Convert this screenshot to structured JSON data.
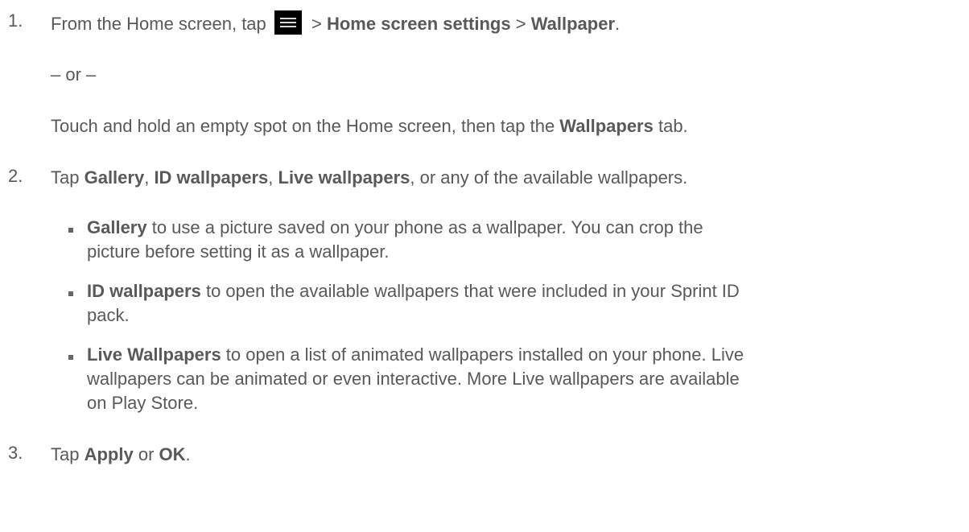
{
  "step1": {
    "number": "1.",
    "pre": "From the Home screen, tap ",
    "icon": "menu-icon",
    "sep1": " > ",
    "bold1": "Home screen settings",
    "sep2": " > ",
    "bold2": "Wallpaper",
    "end": ".",
    "or": "– or –",
    "alt_pre": "Touch and hold an empty spot on the Home screen, then tap the ",
    "alt_bold": "Wallpapers",
    "alt_end": " tab."
  },
  "step2": {
    "number": "2.",
    "pre": "Tap ",
    "b1": "Gallery",
    "s1": ", ",
    "b2": "ID wallpapers",
    "s2": ", ",
    "b3": "Live wallpapers",
    "end": ", or any of the available wallpapers.",
    "bullets": [
      {
        "bold": "Gallery",
        "line1": " to use a picture saved on your phone as a wallpaper. You can crop the",
        "line2": "picture before setting it as a wallpaper."
      },
      {
        "bold": "ID wallpapers",
        "line1": " to open the available wallpapers that were included in your Sprint ID",
        "line2": "pack."
      },
      {
        "bold": "Live Wallpapers",
        "line1": " to open a list of animated wallpapers installed on your phone. Live",
        "line2": "wallpapers can be animated or even interactive. More Live wallpapers are available",
        "line3": "on Play Store."
      }
    ]
  },
  "step3": {
    "number": "3.",
    "pre": "Tap ",
    "b1": "Apply",
    "mid": " or ",
    "b2": "OK",
    "end": "."
  }
}
